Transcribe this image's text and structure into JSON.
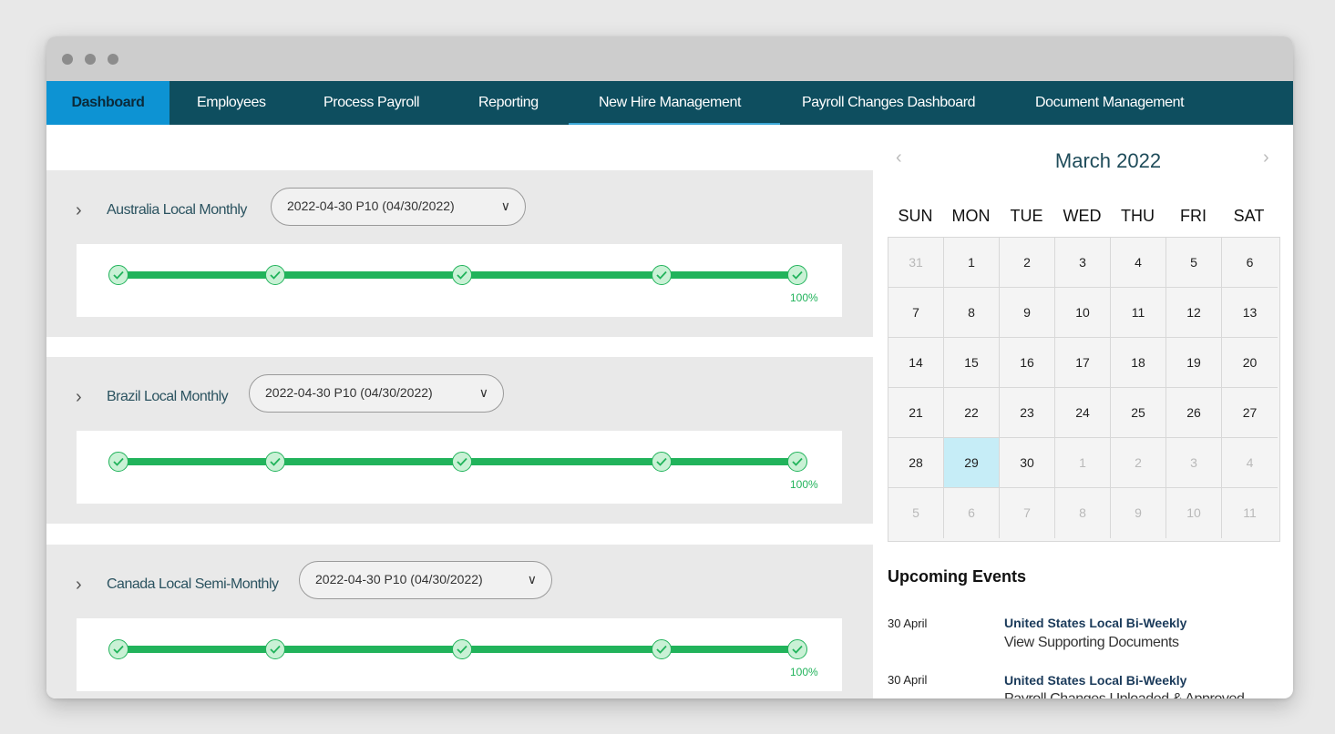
{
  "nav": {
    "items": [
      {
        "label": "Dashboard"
      },
      {
        "label": "Employees"
      },
      {
        "label": "Process Payroll"
      },
      {
        "label": "Reporting"
      },
      {
        "label": "New Hire Management"
      },
      {
        "label": "Payroll Changes Dashboard"
      },
      {
        "label": "Document Management"
      }
    ]
  },
  "payrolls": [
    {
      "name": "Australia Local Monthly",
      "period": "2022-04-30 P10 (04/30/2022)",
      "progress_percent": 100,
      "progress_label": "100%"
    },
    {
      "name": "Brazil Local Monthly",
      "period": "2022-04-30 P10 (04/30/2022)",
      "progress_percent": 100,
      "progress_label": "100%"
    },
    {
      "name": "Canada Local Semi-Monthly",
      "period": "2022-04-30 P10 (04/30/2022)",
      "progress_percent": 100,
      "progress_label": "100%"
    }
  ],
  "calendar": {
    "title": "March 2022",
    "days_of_week": [
      "SUN",
      "MON",
      "TUE",
      "WED",
      "THU",
      "FRI",
      "SAT"
    ],
    "weeks": [
      [
        "31",
        "1",
        "2",
        "3",
        "4",
        "5",
        "6"
      ],
      [
        "7",
        "8",
        "9",
        "10",
        "11",
        "12",
        "13"
      ],
      [
        "14",
        "15",
        "16",
        "17",
        "18",
        "19",
        "20"
      ],
      [
        "21",
        "22",
        "23",
        "24",
        "25",
        "26",
        "27"
      ],
      [
        "28",
        "29",
        "30",
        "1",
        "2",
        "3",
        "4"
      ],
      [
        "5",
        "6",
        "7",
        "8",
        "9",
        "10",
        "11"
      ]
    ],
    "selected": "29"
  },
  "events": {
    "title": "Upcoming Events",
    "items": [
      {
        "date": "30 April",
        "name": "United States Local Bi-Weekly",
        "link": "View Supporting Documents"
      },
      {
        "date": "30 April",
        "name": "United States Local Bi-Weekly",
        "link": "Payroll Changes Uploaded & Approved"
      }
    ]
  },
  "colors": {
    "nav_bg": "#0e4e5f",
    "nav_active": "#0d93d3",
    "progress_green": "#21b35b",
    "today_highlight": "#c6edf7"
  }
}
